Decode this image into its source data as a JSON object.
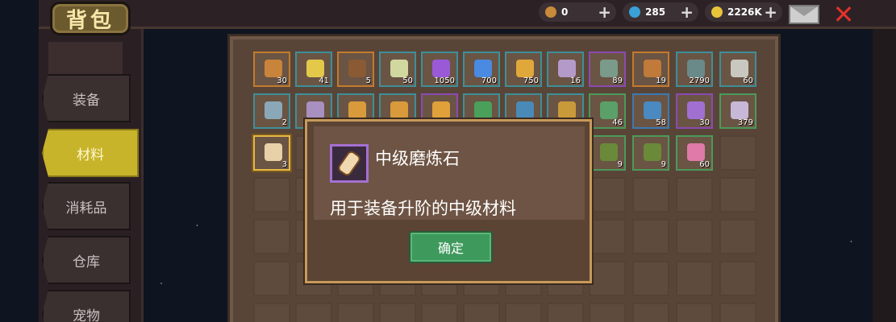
{
  "header": {
    "title": "背包",
    "currencies": [
      {
        "name": "key",
        "icon": "key-icon",
        "value": "0",
        "color": "#c98a3a"
      },
      {
        "name": "gem",
        "icon": "gem-icon",
        "value": "285",
        "color": "#3aa0d8"
      },
      {
        "name": "gold",
        "icon": "coin-icon",
        "value": "2226K",
        "color": "#e8c43a"
      }
    ],
    "plus_label": "+",
    "close_label": "✕"
  },
  "tabs": [
    {
      "label": "装备",
      "active": false
    },
    {
      "label": "材料",
      "active": true
    },
    {
      "label": "消耗品",
      "active": false
    },
    {
      "label": "仓库",
      "active": false
    },
    {
      "label": "宠物",
      "active": false
    }
  ],
  "inventory": {
    "row1": [
      {
        "icon": "key-icon",
        "count": "30",
        "border": "b-brown",
        "color": "#c8843a"
      },
      {
        "icon": "coin-icon",
        "count": "41",
        "border": "b-teal",
        "color": "#e2c94a"
      },
      {
        "icon": "map-icon",
        "count": "5",
        "border": "b-brown",
        "color": "#8a5a34"
      },
      {
        "icon": "orb-icon",
        "count": "50",
        "border": "b-teal",
        "color": "#d0d8a0"
      },
      {
        "icon": "purple-crystal-icon",
        "count": "1050",
        "border": "b-teal",
        "color": "#9a5ad8"
      },
      {
        "icon": "blue-crystal-icon",
        "count": "700",
        "border": "b-teal",
        "color": "#4a8ae0"
      },
      {
        "icon": "gold-crystal-icon",
        "count": "750",
        "border": "b-teal",
        "color": "#e0a83a"
      },
      {
        "icon": "bone-icon",
        "count": "16",
        "border": "b-teal",
        "color": "#b49ac8"
      },
      {
        "icon": "spiral-shell-icon",
        "count": "89",
        "border": "b-purple",
        "color": "#7a9a8a"
      },
      {
        "icon": "spiral-shell-icon",
        "count": "19",
        "border": "b-brown",
        "color": "#c07a3a"
      },
      {
        "icon": "film-icon",
        "count": "2790",
        "border": "b-teal",
        "color": "#6a8a8a"
      },
      {
        "icon": "feather-icon",
        "count": "60",
        "border": "b-teal",
        "color": "#c8c8c0"
      }
    ],
    "row2": [
      {
        "icon": "ore-icon",
        "count": "2",
        "border": "b-teal",
        "color": "#8aa8b8"
      },
      {
        "icon": "ore-icon",
        "count": "",
        "border": "b-teal",
        "color": "#a890c0"
      },
      {
        "icon": "crown-icon",
        "count": "",
        "border": "b-teal",
        "color": "#d89a3a"
      },
      {
        "icon": "crown-icon",
        "count": "",
        "border": "b-teal",
        "color": "#d89a3a"
      },
      {
        "icon": "crown-icon",
        "count": "",
        "border": "b-purple",
        "color": "#e0a03a"
      },
      {
        "icon": "leaf-icon",
        "count": "",
        "border": "b-teal",
        "color": "#4aa05a"
      },
      {
        "icon": "blue-leaf-icon",
        "count": "",
        "border": "b-teal",
        "color": "#4a8ab8"
      },
      {
        "icon": "dagger-icon",
        "count": "",
        "border": "b-teal",
        "color": "#c89a3a"
      },
      {
        "icon": "green-map-icon",
        "count": "46",
        "border": "b-green",
        "color": "#5aa068"
      },
      {
        "icon": "blue-map-icon",
        "count": "58",
        "border": "b-blue",
        "color": "#4a8ac0"
      },
      {
        "icon": "purple-key-icon",
        "count": "30",
        "border": "b-purple",
        "color": "#a070d0"
      },
      {
        "icon": "skull-icon",
        "count": "379",
        "border": "b-green",
        "color": "#c8b8d8"
      }
    ],
    "row3": [
      {
        "icon": "scroll-icon",
        "count": "3",
        "border": "b-selected",
        "color": "#e8d0a8"
      },
      {
        "icon": "empty",
        "count": "",
        "border": "empty",
        "color": ""
      },
      {
        "icon": "empty",
        "count": "",
        "border": "empty",
        "color": ""
      },
      {
        "icon": "empty",
        "count": "",
        "border": "empty",
        "color": ""
      },
      {
        "icon": "empty",
        "count": "",
        "border": "empty",
        "color": ""
      },
      {
        "icon": "empty",
        "count": "",
        "border": "empty",
        "color": ""
      },
      {
        "icon": "empty",
        "count": "",
        "border": "empty",
        "color": ""
      },
      {
        "icon": "green-map-icon",
        "count": "9",
        "border": "b-green",
        "color": "#6a8a3a"
      },
      {
        "icon": "green-map-icon",
        "count": "9",
        "border": "b-green",
        "color": "#6a8a3a"
      },
      {
        "icon": "pink-crystal-icon",
        "count": "60",
        "border": "b-green",
        "color": "#e07aa8"
      },
      {
        "icon": "empty",
        "count": "",
        "border": "empty",
        "color": ""
      }
    ]
  },
  "popup": {
    "item_name": "中级磨炼石",
    "description": "用于装备升阶的中级材料",
    "confirm_label": "确定",
    "icon": "scroll-icon"
  }
}
